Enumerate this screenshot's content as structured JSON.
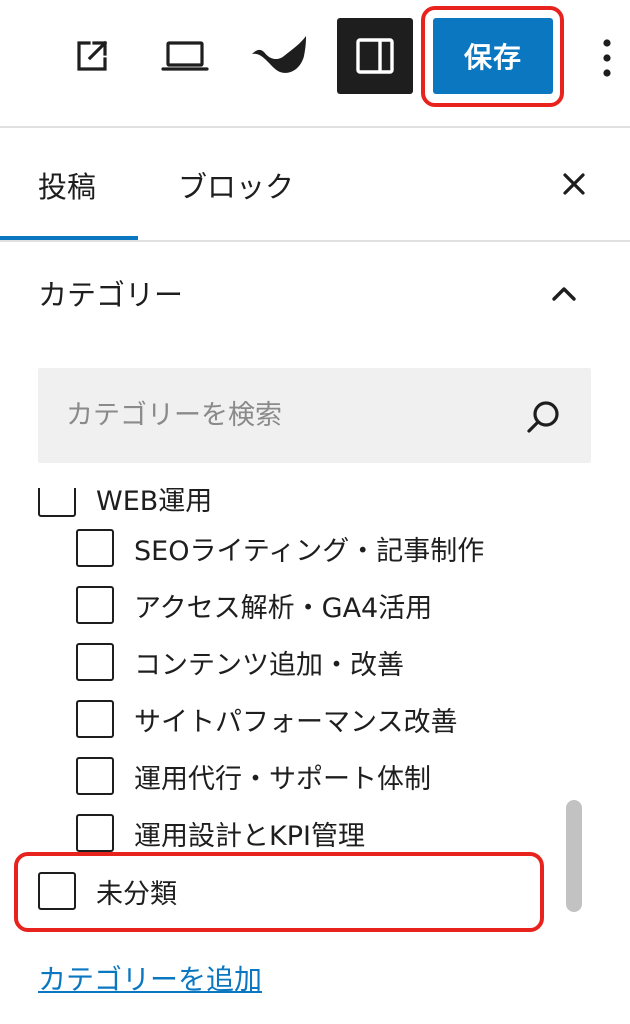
{
  "toolbar": {
    "save_label": "保存"
  },
  "tabs": [
    {
      "label": "投稿",
      "active": true
    },
    {
      "label": "ブロック",
      "active": false
    }
  ],
  "panel": {
    "title": "カテゴリー",
    "search_placeholder": "カテゴリーを検索",
    "categories": [
      {
        "label": "WEB運用",
        "level": 0,
        "checked": false
      },
      {
        "label": "SEOライティング・記事制作",
        "level": 1,
        "checked": false
      },
      {
        "label": "アクセス解析・GA4活用",
        "level": 1,
        "checked": false
      },
      {
        "label": "コンテンツ追加・改善",
        "level": 1,
        "checked": false
      },
      {
        "label": "サイトパフォーマンス改善",
        "level": 1,
        "checked": false
      },
      {
        "label": "運用代行・サポート体制",
        "level": 1,
        "checked": false
      },
      {
        "label": "運用設計とKPI管理",
        "level": 1,
        "checked": false
      },
      {
        "label": "未分類",
        "level": 0,
        "checked": false
      }
    ],
    "add_link": "カテゴリーを追加"
  },
  "colors": {
    "accent": "#0a77c0",
    "highlight": "#e8231e",
    "dark": "#1e1e1e"
  }
}
